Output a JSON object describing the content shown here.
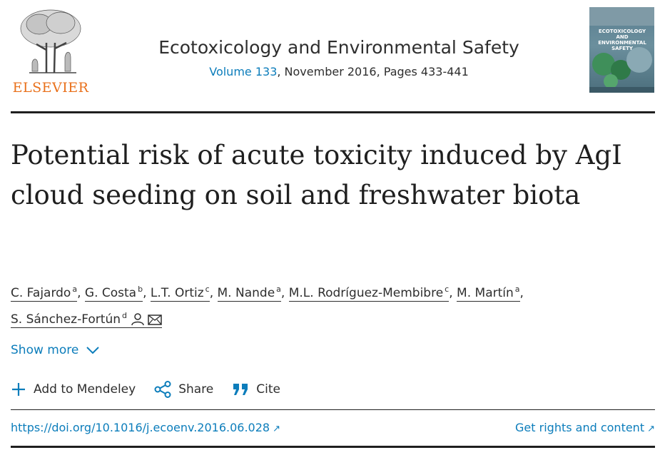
{
  "publisher": {
    "name": "ELSEVIER",
    "brand_color": "#e9711c"
  },
  "journal": {
    "title": "Ecotoxicology and Environmental Safety",
    "volume_link": "Volume 133",
    "issue_rest": ", November 2016, Pages 433-441",
    "cover_title": "ECOTOXICOLOGY AND ENVIRONMENTAL SAFETY"
  },
  "article": {
    "title": "Potential risk of acute toxicity induced by AgI cloud seeding on soil and freshwater biota"
  },
  "authors": [
    {
      "name": "C. Fajardo",
      "sup": "a"
    },
    {
      "name": "G. Costa",
      "sup": "b"
    },
    {
      "name": "L.T. Ortiz",
      "sup": "c"
    },
    {
      "name": "M. Nande",
      "sup": "a"
    },
    {
      "name": "M.L. Rodríguez-Membibre",
      "sup": "c"
    },
    {
      "name": "M. Martín",
      "sup": "a"
    },
    {
      "name": "S. Sánchez-Fortún",
      "sup": "d"
    }
  ],
  "show_more": {
    "label": "Show more",
    "icon": "chevron-down-icon"
  },
  "actions": {
    "mendeley": {
      "label": "Add to Mendeley",
      "icon": "plus-icon"
    },
    "share": {
      "label": "Share",
      "icon": "share-icon"
    },
    "cite": {
      "label": "Cite",
      "icon": "quote-icon"
    }
  },
  "links": {
    "doi": "https://doi.org/10.1016/j.ecoenv.2016.06.028",
    "rights": "Get rights and content"
  },
  "colors": {
    "link": "#0c7dbb",
    "text": "#2e2e2e"
  }
}
